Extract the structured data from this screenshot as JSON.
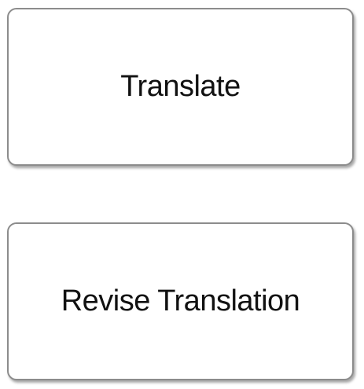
{
  "boxes": [
    {
      "label": "Translate"
    },
    {
      "label": "Revise Translation"
    }
  ]
}
